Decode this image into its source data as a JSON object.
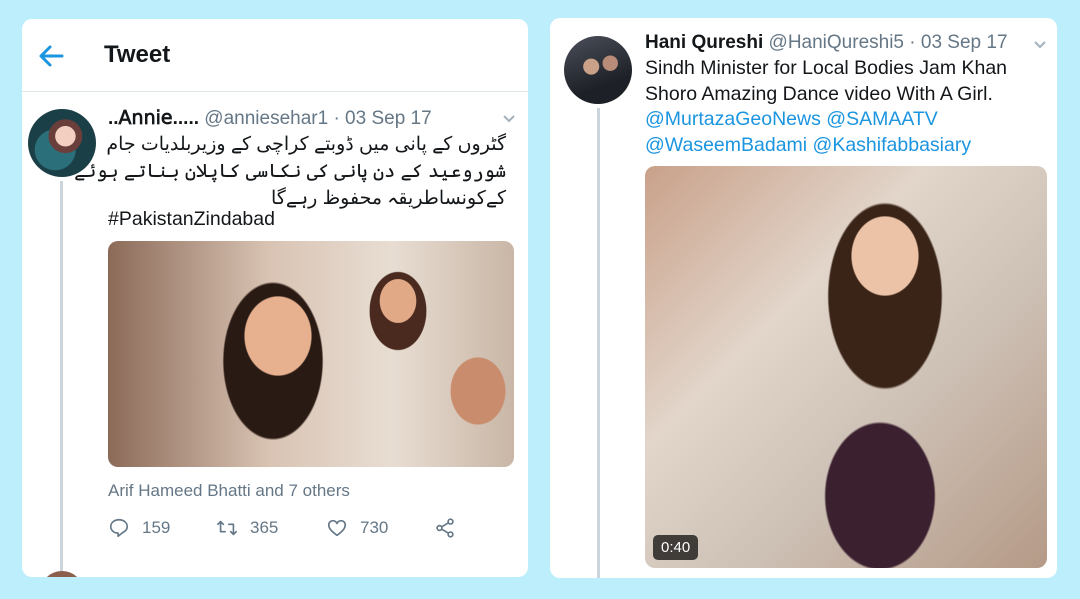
{
  "left_tweet": {
    "header_title": "Tweet",
    "author_name": "..𝖠𝗇𝗇𝗂𝖾.....",
    "author_handle": "@anniesehar1",
    "date": "· 03 Sep 17",
    "text_lines": [
      "گٹروں کے پانی میں ڈوبتے کراچی کے وزیربلدیات جام",
      "شوروعید کے دن پانی کی نکاسی کاپلان بناتے ہوئے",
      "کےکونساطریقہ محفوظ رہےگا"
    ],
    "hashtag": "#PakistanZindabad",
    "liked_by": "Arif Hameed Bhatti and 7 others",
    "reply_count": "159",
    "retweet_count": "365",
    "like_count": "730"
  },
  "right_tweet": {
    "author_name": "Hani Qureshi",
    "author_handle": "@HaniQureshi5",
    "date": "· 03 Sep 17",
    "text_lines": [
      "Sindh Minister for Local Bodies Jam Khan",
      "Shoro Amazing Dance video With A Girl."
    ],
    "mentions_line1": "@MurtazaGeoNews @SAMAATV",
    "mentions_line2": "@WaseemBadami @Kashifabbasiary",
    "video_duration": "0:40"
  },
  "colors": {
    "background": "#bdeefb",
    "link": "#1b95e0",
    "text": "#14171a",
    "muted": "#657786"
  },
  "icons": [
    "back-arrow-icon",
    "chevron-down-icon",
    "reply-icon",
    "retweet-icon",
    "like-icon",
    "share-icon"
  ]
}
